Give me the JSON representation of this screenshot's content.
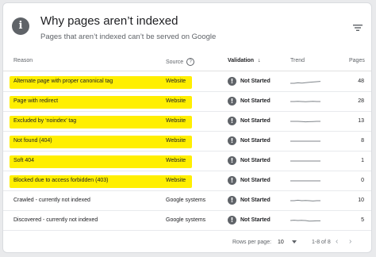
{
  "header": {
    "title": "Why pages aren’t indexed",
    "subtitle": "Pages that aren’t indexed can’t be served on Google",
    "info_icon_glyph": "i"
  },
  "columns": {
    "reason": "Reason",
    "source": "Source",
    "source_help_glyph": "?",
    "validation": "Validation",
    "sort_arrow": "↓",
    "trend": "Trend",
    "pages": "Pages"
  },
  "rows": [
    {
      "reason": "Alternate page with proper canonical tag",
      "source": "Website",
      "validation": "Not Started",
      "pages": "48",
      "highlighted": true,
      "trend": [
        2,
        2,
        2.3,
        2.1,
        2.4,
        2.6,
        2.8,
        3,
        3.2
      ]
    },
    {
      "reason": "Page with redirect",
      "source": "Website",
      "validation": "Not Started",
      "pages": "28",
      "highlighted": true,
      "trend": [
        3,
        3,
        3.1,
        3,
        2.9,
        3,
        3.1,
        3,
        3
      ]
    },
    {
      "reason": "Excluded by ‘noindex’ tag",
      "source": "Website",
      "validation": "Not Started",
      "pages": "13",
      "highlighted": true,
      "trend": [
        3,
        3,
        3,
        2.9,
        2.7,
        2.8,
        2.9,
        3,
        3
      ]
    },
    {
      "reason": "Not found (404)",
      "source": "Website",
      "validation": "Not Started",
      "pages": "8",
      "highlighted": true,
      "trend": [
        3,
        3,
        3,
        3,
        3,
        3,
        3,
        3,
        3
      ]
    },
    {
      "reason": "Soft 404",
      "source": "Website",
      "validation": "Not Started",
      "pages": "1",
      "highlighted": true,
      "trend": [
        3,
        3,
        3,
        3,
        3,
        3,
        3,
        3,
        3
      ]
    },
    {
      "reason": "Blocked due to access forbidden (403)",
      "source": "Website",
      "validation": "Not Started",
      "pages": "0",
      "highlighted": true,
      "trend": [
        3,
        3,
        3,
        3,
        3,
        3,
        3,
        3,
        3
      ]
    },
    {
      "reason": "Crawled - currently not indexed",
      "source": "Google systems",
      "validation": "Not Started",
      "pages": "10",
      "highlighted": false,
      "trend": [
        3,
        3,
        3.3,
        3,
        3.1,
        3,
        2.8,
        3,
        3
      ]
    },
    {
      "reason": "Discovered - currently not indexed",
      "source": "Google systems",
      "validation": "Not Started",
      "pages": "5",
      "highlighted": false,
      "trend": [
        3,
        3.2,
        3,
        3.1,
        3,
        2.6,
        2.7,
        2.8,
        2.8
      ]
    }
  ],
  "status_icon_glyph": "!",
  "footer": {
    "rows_per_page_label": "Rows per page:",
    "rows_per_page_value": "10",
    "range": "1-8 of 8",
    "prev_glyph": "‹",
    "next_glyph": "›"
  },
  "colors": {
    "highlight": "#ffef00",
    "status_icon": "#5f6368",
    "trend_line": "#80868b"
  }
}
